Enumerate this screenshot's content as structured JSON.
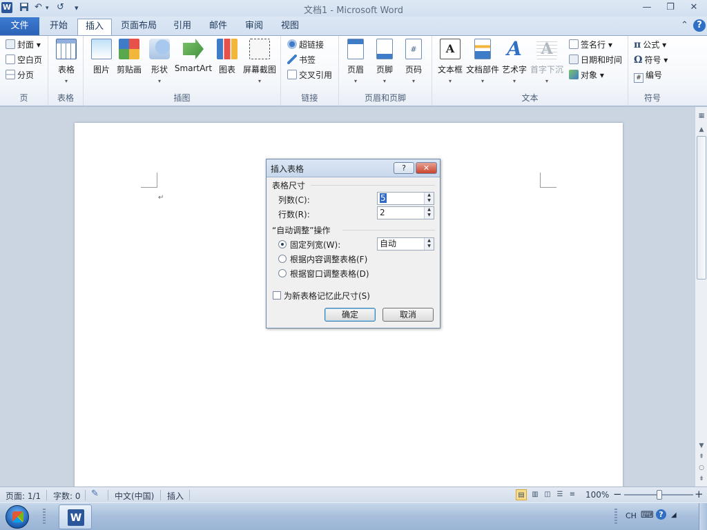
{
  "window": {
    "title": "文档1  -  Microsoft Word",
    "app_icon": "W",
    "qat": {
      "save_icon": "save-icon",
      "undo_glyph": "↶",
      "redo_glyph": "↺",
      "customize_glyph": "▾"
    },
    "controls": {
      "minimize": "—",
      "restore": "❐",
      "close": "✕"
    }
  },
  "tabs": {
    "file": "文件",
    "items": [
      "开始",
      "插入",
      "页面布局",
      "引用",
      "邮件",
      "审阅",
      "视图"
    ],
    "active": "插入",
    "collapse_glyph": "⌃",
    "help_glyph": "?"
  },
  "ribbon": {
    "groups": {
      "pages": {
        "label": "页",
        "items": [
          "封面 ▾",
          "空白页",
          "分页"
        ]
      },
      "table": {
        "label": "表格",
        "button": "表格"
      },
      "illustrations": {
        "label": "插图",
        "buttons": [
          "图片",
          "剪贴画",
          "形状",
          "SmartArt",
          "图表",
          "屏幕截图"
        ]
      },
      "links": {
        "label": "链接",
        "items": [
          "超链接",
          "书签",
          "交叉引用"
        ]
      },
      "header_footer": {
        "label": "页眉和页脚",
        "buttons": [
          "页眉",
          "页脚",
          "页码"
        ]
      },
      "text": {
        "label": "文本",
        "buttons": [
          "文本框",
          "文档部件",
          "艺术字",
          "首字下沉"
        ],
        "items": [
          "签名行 ▾",
          "日期和时间",
          "对象 ▾"
        ]
      },
      "symbols": {
        "label": "符号",
        "items": [
          "公式 ▾",
          "符号 ▾",
          "编号"
        ],
        "glyphs": [
          "π",
          "Ω",
          "#"
        ]
      }
    }
  },
  "document": {
    "paragraph_mark": "↵"
  },
  "dialog": {
    "title": "插入表格",
    "help": "?",
    "close": "✕",
    "size_section": "表格尺寸",
    "columns_label": "列数(C):",
    "columns_value": "5",
    "rows_label": "行数(R):",
    "rows_value": "2",
    "autofit_section": "“自动调整”操作",
    "fixed_width_label": "固定列宽(W):",
    "fixed_width_value": "自动",
    "autofit_contents_label": "根据内容调整表格(F)",
    "autofit_window_label": "根据窗口调整表格(D)",
    "selected_option": "fixed",
    "remember_label": "为新表格记忆此尺寸(S)",
    "remember_checked": false,
    "ok": "确定",
    "cancel": "取消"
  },
  "statusbar": {
    "page": "页面: 1/1",
    "words": "字数: 0",
    "language": "中文(中国)",
    "mode": "插入",
    "zoom": "100%",
    "zoom_minus": "−",
    "zoom_plus": "+",
    "zoom_level": 1.0
  },
  "taskbar": {
    "word_icon": "W",
    "lang": "CH",
    "help": "?"
  }
}
